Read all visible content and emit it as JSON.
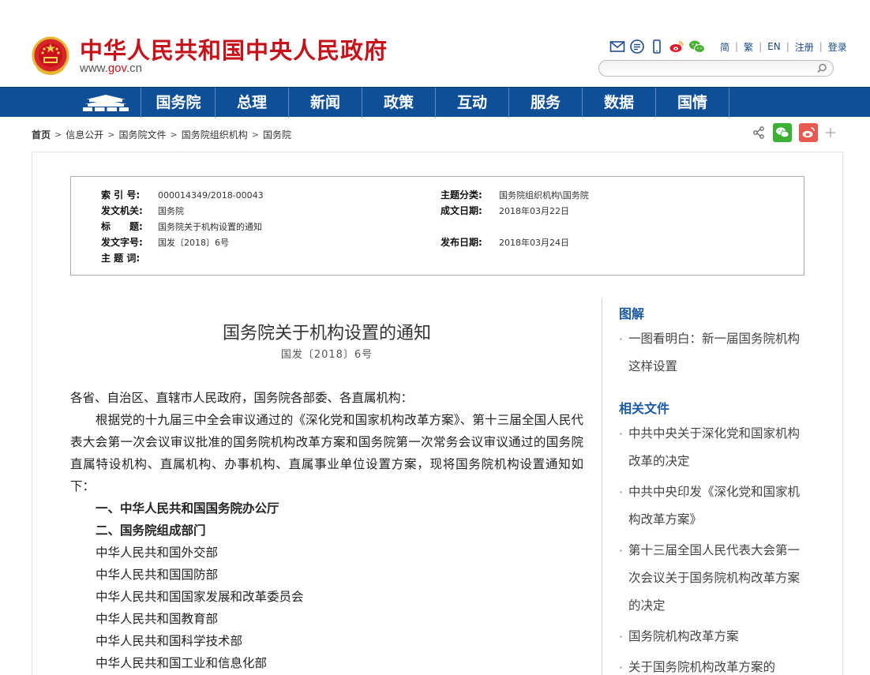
{
  "header": {
    "site_title": "中华人民共和国中央人民政府",
    "site_url_prefix": "www.",
    "site_url_gov": "gov",
    "site_url_dot": ".",
    "site_url_suffix": "cn",
    "tool_icons": [
      "mail-icon",
      "rss-icon",
      "mobile-icon",
      "weibo-icon",
      "wechat-icon"
    ],
    "links": [
      "简",
      "繁",
      "EN",
      "注册",
      "登录"
    ],
    "search_placeholder": ""
  },
  "nav": {
    "items": [
      "国务院",
      "总理",
      "新闻",
      "政策",
      "互动",
      "服务",
      "数据",
      "国情"
    ]
  },
  "breadcrumb": [
    "首页",
    "信息公开",
    "国务院文件",
    "国务院组织机构",
    "国务院"
  ],
  "meta": {
    "index_label": "索 引 号:",
    "index_value": "000014349/2018-00043",
    "subject_label": "主题分类:",
    "subject_value": "国务院组织机构\\国务院",
    "issuer_label": "发文机关:",
    "issuer_value": "国务院",
    "written_label": "成文日期:",
    "written_value": "2018年03月22日",
    "title_label": "标　　题:",
    "title_value": "国务院关于机构设置的通知",
    "docno_label": "发文字号:",
    "docno_value": "国发〔2018〕6号",
    "pub_label": "发布日期:",
    "pub_value": "2018年03月24日",
    "keywords_label": "主 题 词:",
    "keywords_value": ""
  },
  "article": {
    "title": "国务院关于机构设置的通知",
    "doc_number": "国发〔2018〕6号",
    "salutation": "各省、自治区、直辖市人民政府，国务院各部委、各直属机构：",
    "intro": "根据党的十九届三中全会审议通过的《深化党和国家机构改革方案》、第十三届全国人民代表大会第一次会议审议批准的国务院机构改革方案和国务院第一次常务会议审议通过的国务院直属特设机构、直属机构、办事机构、直属事业单位设置方案，现将国务院机构设置通知如下：",
    "section1": "一、中华人民共和国国务院办公厅",
    "section2": "二、国务院组成部门",
    "departments": [
      "中华人民共和国外交部",
      "中华人民共和国国防部",
      "中华人民共和国国家发展和改革委员会",
      "中华人民共和国教育部",
      "中华人民共和国科学技术部",
      "中华人民共和国工业和信息化部"
    ]
  },
  "sidebar": {
    "illustration_heading": "图解",
    "illustration_items": [
      "一图看明白：新一届国务院机构这样设置"
    ],
    "related_heading": "相关文件",
    "related_items": [
      "中共中央关于深化党和国家机构改革的决定",
      "中共中央印发《深化党和国家机构改革方案》",
      "第十三届全国人民代表大会第一次会议关于国务院机构改革方案的决定",
      "国务院机构改革方案",
      "关于国务院机构改革方案的"
    ]
  },
  "colors": {
    "brand_red": "#c6131b",
    "nav_blue": "#0e4f97",
    "link_blue": "#1b5aa3"
  }
}
